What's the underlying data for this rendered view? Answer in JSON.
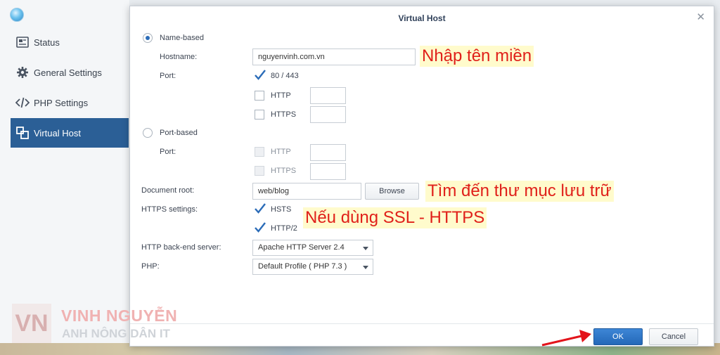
{
  "sidebar": {
    "items": [
      {
        "label": "Status",
        "icon": "status-icon"
      },
      {
        "label": "General Settings",
        "icon": "gear-icon"
      },
      {
        "label": "PHP Settings",
        "icon": "code-icon"
      },
      {
        "label": "Virtual Host",
        "icon": "virtual-host-icon",
        "active": true
      }
    ]
  },
  "dialog": {
    "title": "Virtual Host",
    "name_based": {
      "label": "Name-based",
      "selected": true,
      "hostname_label": "Hostname:",
      "hostname_value": "nguyenvinh.com.vn",
      "port_label": "Port:",
      "port_80_443": {
        "label": "80 / 443",
        "checked": true
      },
      "http_label": "HTTP",
      "https_label": "HTTPS"
    },
    "port_based": {
      "label": "Port-based",
      "selected": false,
      "port_label": "Port:",
      "http_label": "HTTP",
      "https_label": "HTTPS"
    },
    "document_root": {
      "label": "Document root:",
      "value": "web/blog",
      "browse_label": "Browse"
    },
    "https_settings": {
      "label": "HTTPS settings:",
      "hsts_label": "HSTS",
      "hsts_checked": true,
      "http2_label": "HTTP/2",
      "http2_checked": true
    },
    "backend": {
      "label": "HTTP back-end server:",
      "value": "Apache HTTP Server 2.4"
    },
    "php": {
      "label": "PHP:",
      "value": "Default Profile ( PHP 7.3 )"
    },
    "ok_label": "OK",
    "cancel_label": "Cancel"
  },
  "annotations": {
    "hostname_note": "Nhập tên miền",
    "docroot_note": "Tìm đến thư mục lưu trữ",
    "ssl_note": "Nếu dùng SSL - HTTPS"
  },
  "watermark": {
    "logo_text": "VN",
    "name": "VINH NGUYỄN",
    "subtitle": "ANH NÔNG DÂN IT"
  },
  "colors": {
    "accent": "#2b5f96",
    "ok_button": "#2468b8",
    "annotation_text": "#e0201a",
    "annotation_bg": "#fffbcc",
    "arrow": "#e3141b"
  }
}
